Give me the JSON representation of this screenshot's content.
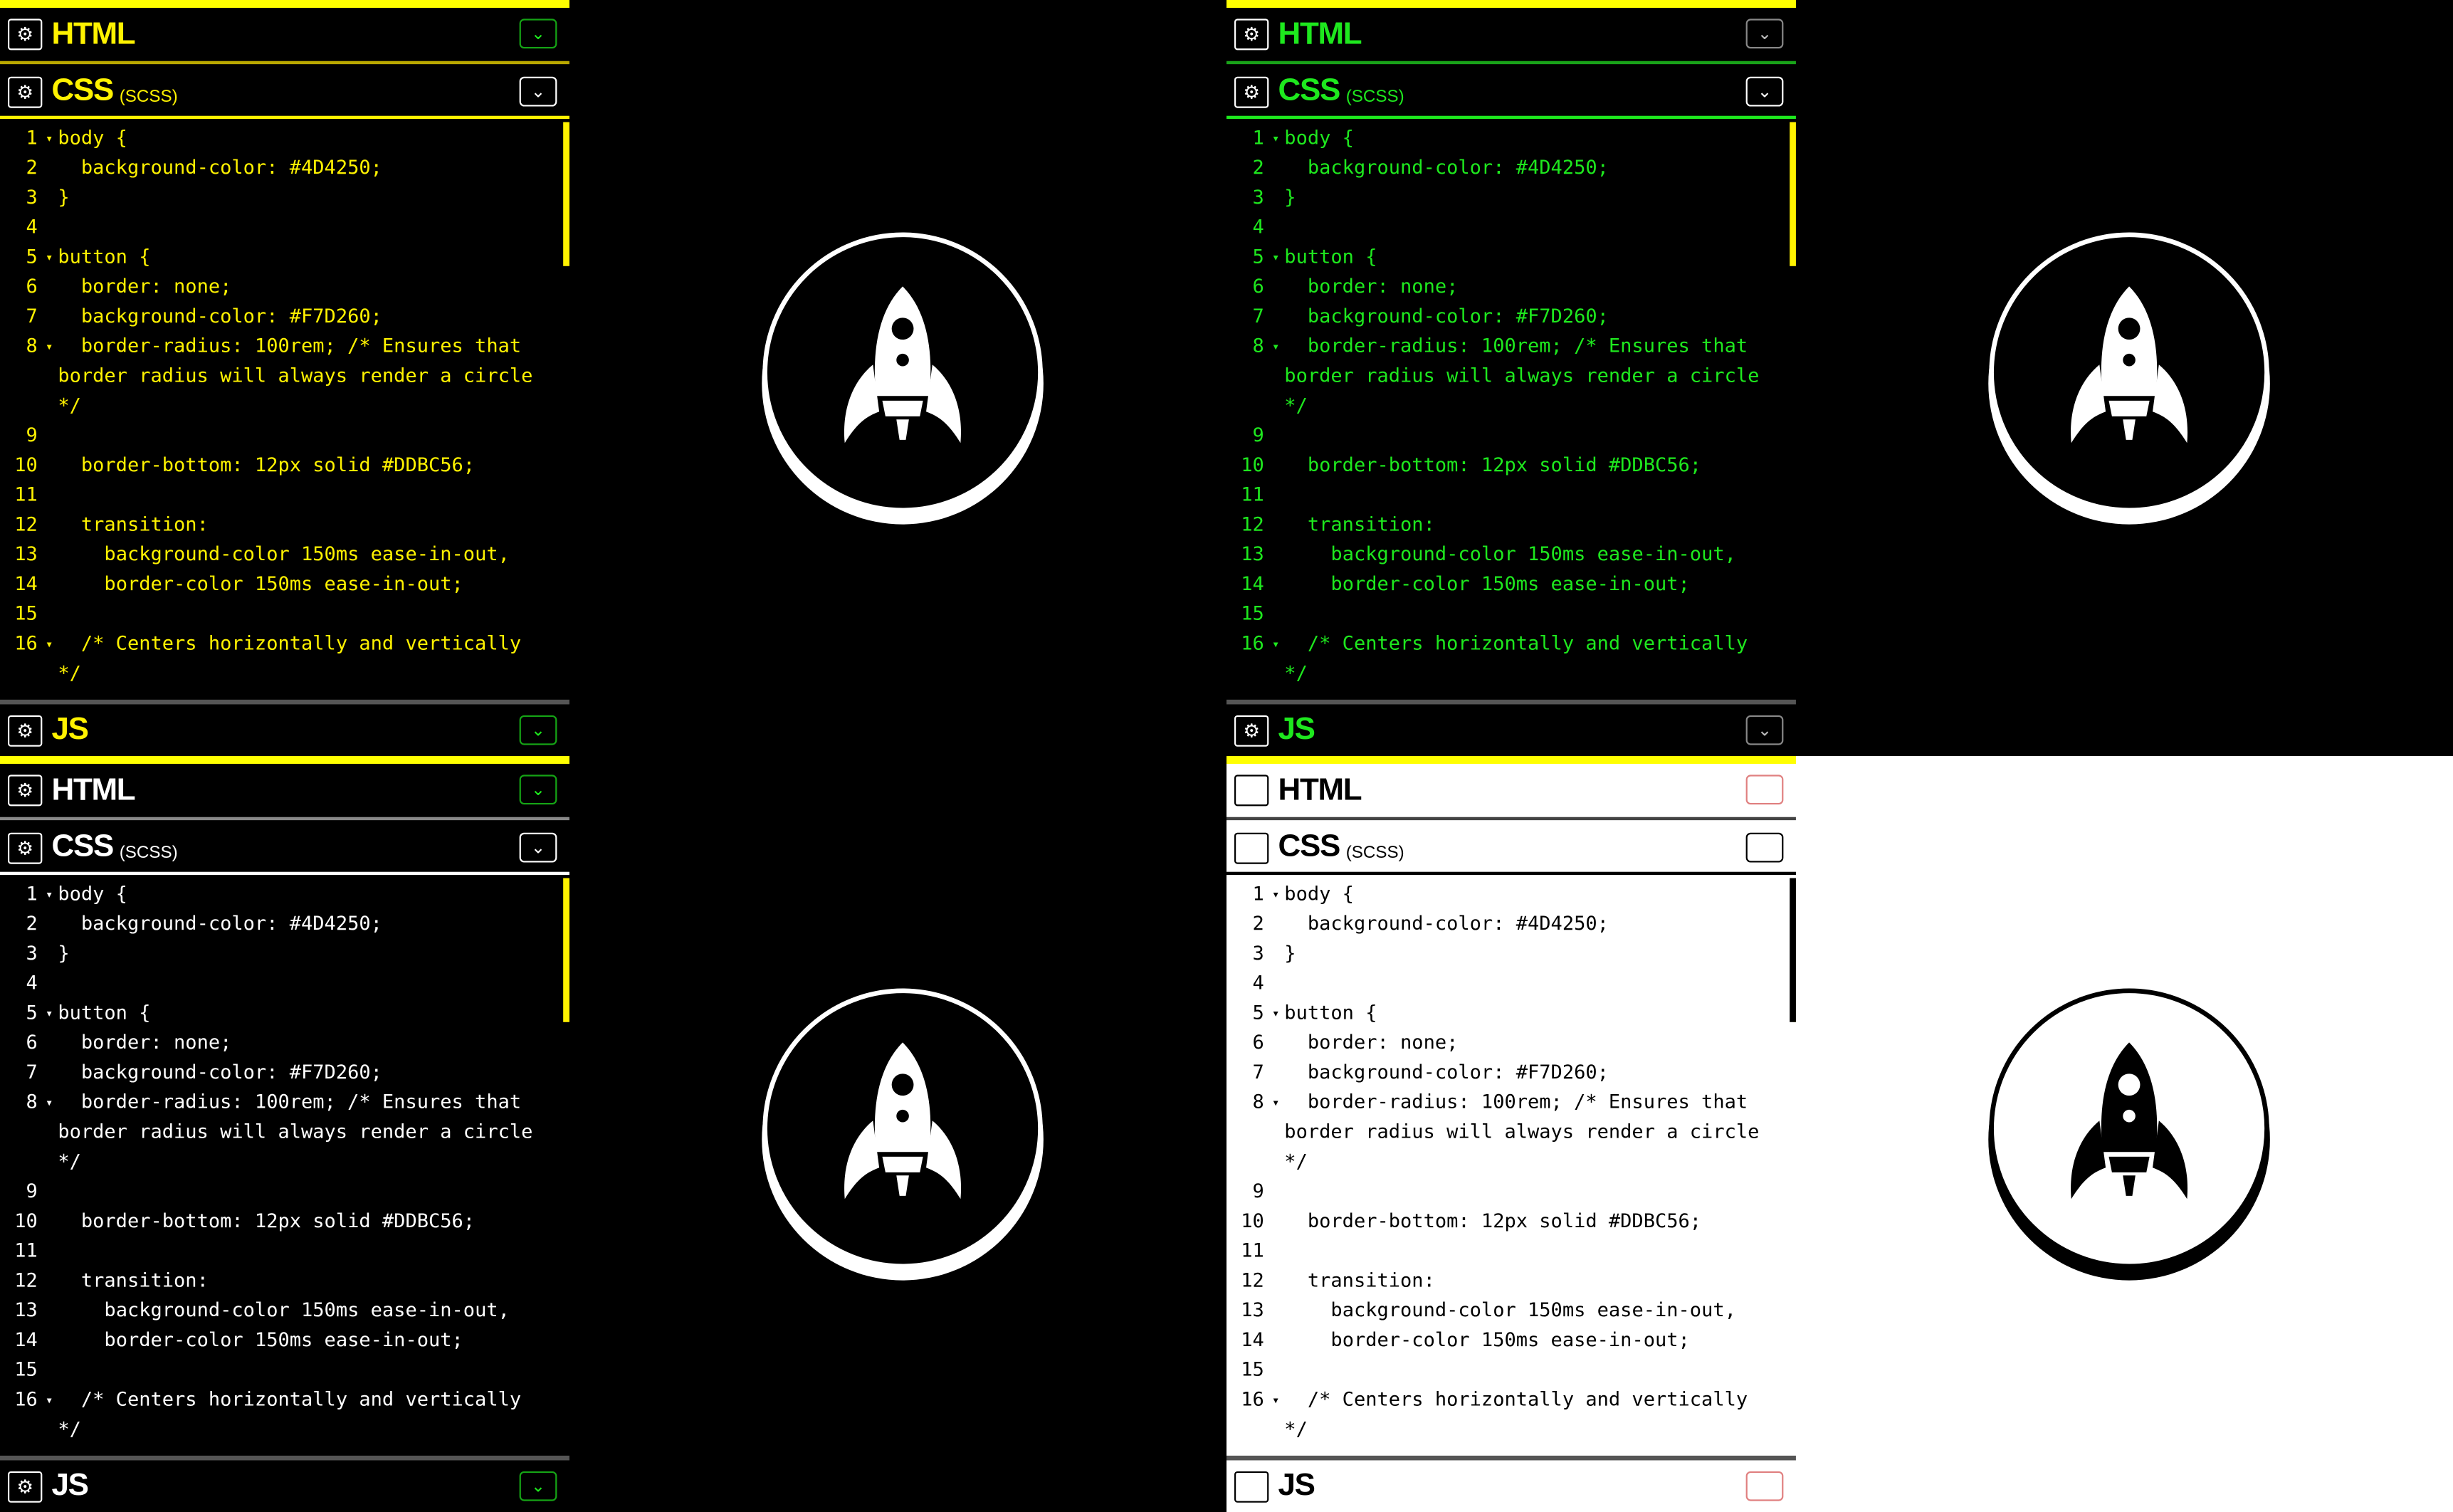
{
  "panes": {
    "html_title": "HTML",
    "css_title": "CSS",
    "css_subtitle": "(SCSS)",
    "js_title": "JS"
  },
  "icons": {
    "gear": "gear-icon",
    "caret": "chevron-down-icon",
    "rocket": "rocket-icon"
  },
  "colors": {
    "yellow_theme": "#FFF200",
    "green_theme": "#1EE81E",
    "caret_green_border": "#15A315",
    "light_caret_red": "#E08080",
    "accent_bar": "#FFFF00"
  },
  "code_lines": [
    {
      "n": "1",
      "fold": true,
      "text": "body {"
    },
    {
      "n": "2",
      "fold": false,
      "text": "  background-color: #4D4250;"
    },
    {
      "n": "3",
      "fold": false,
      "text": "}"
    },
    {
      "n": "4",
      "fold": false,
      "text": ""
    },
    {
      "n": "5",
      "fold": true,
      "text": "button {"
    },
    {
      "n": "6",
      "fold": false,
      "text": "  border: none;"
    },
    {
      "n": "7",
      "fold": false,
      "text": "  background-color: #F7D260;"
    },
    {
      "n": "8",
      "fold": true,
      "text": "  border-radius: 100rem; /* Ensures that border radius will always render a circle */"
    },
    {
      "n": "9",
      "fold": false,
      "text": ""
    },
    {
      "n": "10",
      "fold": false,
      "text": "  border-bottom: 12px solid #DDBC56;"
    },
    {
      "n": "11",
      "fold": false,
      "text": ""
    },
    {
      "n": "12",
      "fold": false,
      "text": "  transition:"
    },
    {
      "n": "13",
      "fold": false,
      "text": "    background-color 150ms ease-in-out,"
    },
    {
      "n": "14",
      "fold": false,
      "text": "    border-color 150ms ease-in-out;"
    },
    {
      "n": "15",
      "fold": false,
      "text": ""
    },
    {
      "n": "16",
      "fold": true,
      "text": "  /* Centers horizontally and vertically */"
    }
  ],
  "fold_glyph": "▾"
}
